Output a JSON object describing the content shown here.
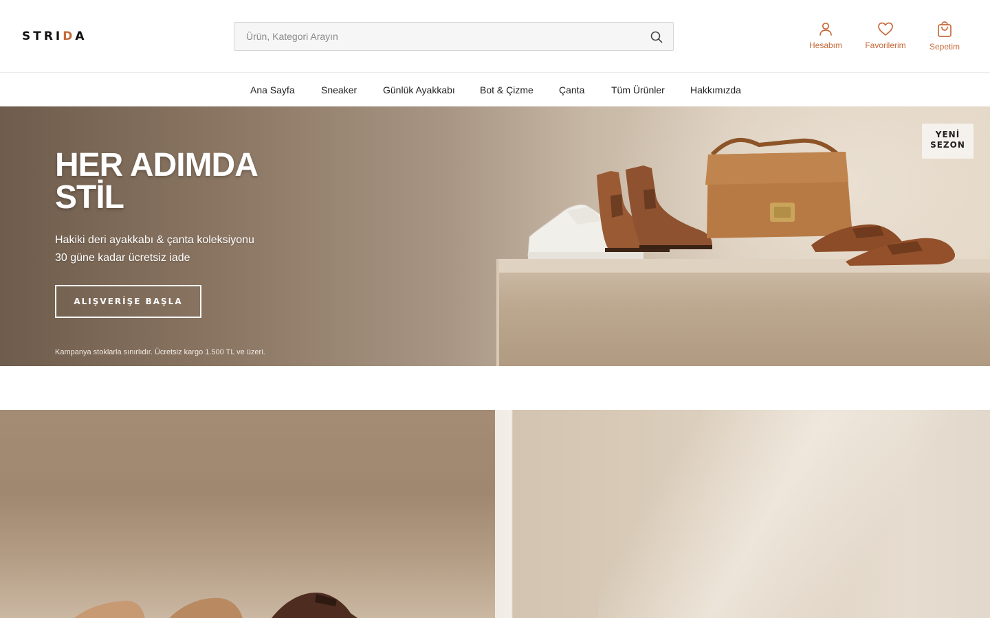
{
  "header": {
    "logo_prefix": "STRI",
    "logo_accent": "D",
    "logo_suffix": "A",
    "search_placeholder": "Ürün, Kategori Arayın",
    "actions": {
      "account": "Hesabım",
      "favorites": "Favorilerim",
      "cart": "Sepetim"
    }
  },
  "nav": {
    "items": [
      "Ana Sayfa",
      "Sneaker",
      "Günlük Ayakkabı",
      "Bot & Çizme",
      "Çanta",
      "Tüm Ürünler",
      "Hakkımızda"
    ]
  },
  "hero": {
    "title_line1": "HER ADIMDA",
    "title_line2": "STİL",
    "subtitle_line1": "Hakiki deri ayakkabı & çanta koleksiyonu",
    "subtitle_line2": "30 güne kadar ücretsiz iade",
    "cta": "ALIŞVERİŞE BAŞLA",
    "note": "Kampanya stoklarla sınırlıdır. Ücretsiz kargo 1.500 TL ve üzeri.",
    "badge_line1": "YENİ",
    "badge_line2": "SEZON"
  },
  "colors": {
    "accent": "#c46a3a",
    "text": "#1a1a1a"
  }
}
